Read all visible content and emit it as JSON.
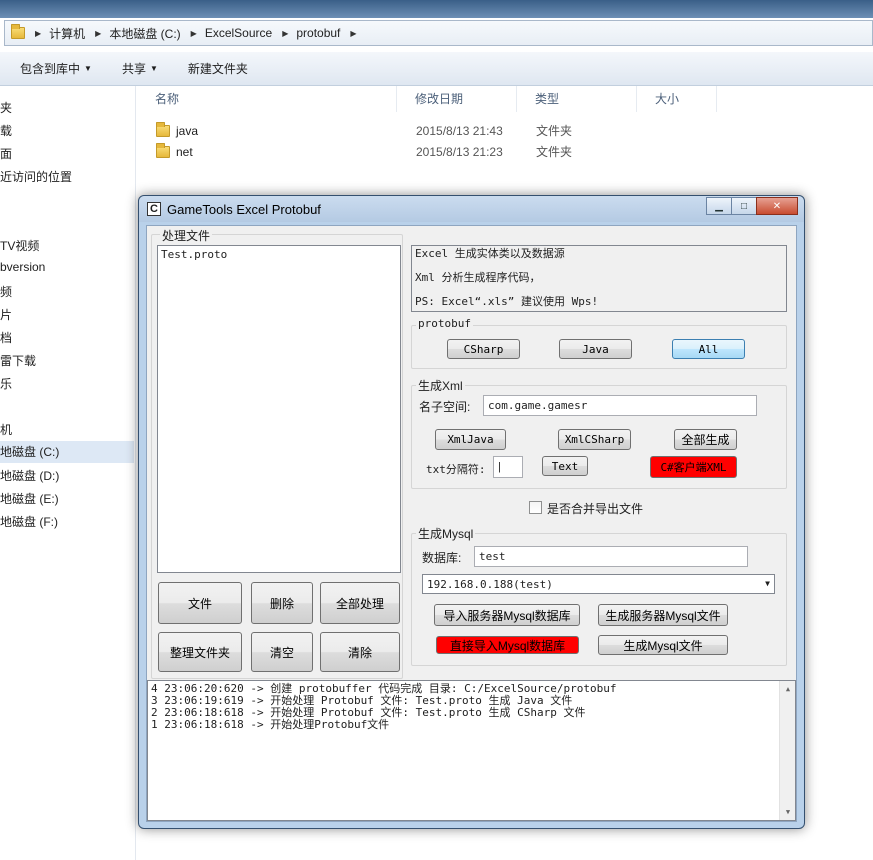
{
  "explorer": {
    "breadcrumb": [
      "计算机",
      "本地磁盘 (C:)",
      "ExcelSource",
      "protobuf"
    ],
    "commands": [
      "包含到库中",
      "共享",
      "新建文件夹"
    ],
    "nav_items": [
      "夹",
      "载",
      "面",
      "近访问的位置",
      "TV视频",
      "bversion",
      "频",
      "片",
      "档",
      "雷下载",
      "乐",
      "机",
      "地磁盘 (C:)",
      "地磁盘 (D:)",
      "地磁盘 (E:)",
      "地磁盘 (F:)"
    ],
    "columns": {
      "name": "名称",
      "date": "修改日期",
      "type": "类型",
      "size": "大小"
    },
    "files": [
      {
        "name": "java",
        "date": "2015/8/13 21:43",
        "type": "文件夹"
      },
      {
        "name": "net",
        "date": "2015/8/13 21:23",
        "type": "文件夹"
      }
    ]
  },
  "app": {
    "title": "GameTools Excel Protobuf",
    "icon_letter": "C",
    "process_group_label": "处理文件",
    "file_list": [
      "Test.proto"
    ],
    "file_buttons": {
      "file": "文件",
      "delete": "删除",
      "process_all": "全部处理",
      "organize_folder": "整理文件夹",
      "clear": "清空",
      "clean": "清除"
    },
    "info_lines": [
      "Excel 生成实体类以及数据源",
      "Xml 分析生成程序代码，",
      "PS: Excel“.xls” 建议使用 Wps!"
    ],
    "protobuf": {
      "label": "protobuf",
      "csharp": "CSharp",
      "java": "Java",
      "all": "All"
    },
    "xml": {
      "label": "生成Xml",
      "namespace_label": "名子空间:",
      "namespace_value": "com.game.gamesr",
      "xml_java": "XmlJava",
      "xml_csharp": "XmlCSharp",
      "generate_all": "全部生成",
      "separator_label": "txt分隔符:",
      "separator_value": "|",
      "text": "Text",
      "client_xml": "C#客户端XML"
    },
    "merge_export_label": "是否合并导出文件",
    "mysql": {
      "label": "生成Mysql",
      "db_label": "数据库:",
      "db_value": "test",
      "server_selected": "192.168.0.188(test)",
      "import_server": "导入服务器Mysql数据库",
      "gen_server_file": "生成服务器Mysql文件",
      "direct_import": "直接导入Mysql数据库",
      "gen_file": "生成Mysql文件"
    },
    "log_lines": [
      "4 23:06:20:620 -> 创建 protobuffer 代码完成 目录: C:/ExcelSource/protobuf",
      "3 23:06:19:619 -> 开始处理 Protobuf 文件: Test.proto 生成 Java 文件",
      "2 23:06:18:618 -> 开始处理 Protobuf 文件: Test.proto 生成 CSharp 文件",
      "1 23:06:18:618 -> 开始处理Protobuf文件"
    ]
  },
  "icons": {
    "folder": "folder-icon",
    "minimize": "minimize-icon",
    "maximize": "maximize-icon",
    "close": "close-icon"
  }
}
